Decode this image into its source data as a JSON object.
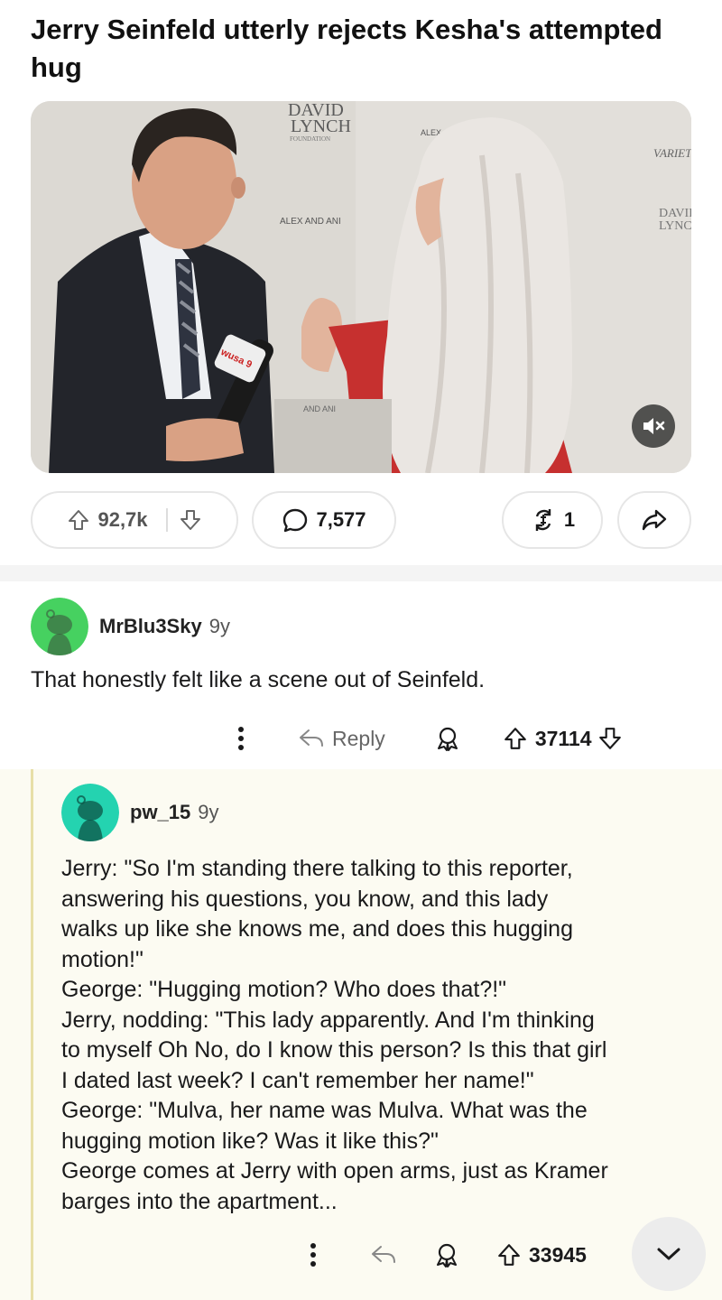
{
  "post": {
    "title": "Jerry Seinfeld utterly rejects Kesha's attempted hug",
    "media": {
      "backdrop_texts": [
        "DAVID",
        "LYNCH",
        "FOUNDATION",
        "ALEX AND ANI",
        "ALEX",
        "VARIETY",
        "DAVID",
        "LYNCH",
        "wusa 9",
        "AND ANI"
      ],
      "mute_icon": "speaker-muted-icon"
    },
    "actions": {
      "upvote_icon": "upvote-arrow-icon",
      "score": "92,7k",
      "downvote_icon": "downvote-arrow-icon",
      "comment_icon": "speech-bubble-icon",
      "comments": "7,577",
      "award_icon": "award-icon",
      "awards": "1",
      "share_icon": "share-arrow-icon"
    }
  },
  "comments": [
    {
      "username": "MrBlu3Sky",
      "age": "9y",
      "avatar_color": "#46d160",
      "text": "That honestly felt like a scene out of Seinfeld.",
      "more_icon": "more-vertical-icon",
      "reply_label": "Reply",
      "score": "37114"
    },
    {
      "username": "pw_15",
      "age": "9y",
      "avatar_color": "#24d3b0",
      "lines": [
        "Jerry: \"So I'm standing there talking to this reporter,",
        "answering his questions, you know, and this lady",
        "walks up like she knows me, and does this hugging",
        "motion!\"",
        "George: \"Hugging motion? Who does that?!\"",
        "Jerry, nodding: \"This lady apparently. And I'm thinking",
        "to myself Oh No, do I know this person? Is this that girl",
        "I dated last week? I can't remember her name!\"",
        "George: \"Mulva, her name was Mulva. What was the",
        "hugging motion like? Was it like this?\"",
        "George comes at Jerry with open arms, just as Kramer",
        "barges into the apartment..."
      ],
      "score": "33945",
      "collapse_icon": "chevron-down-icon"
    }
  ],
  "colors": {
    "thread_line": "#e7dfa8",
    "reply_background": "#fcfbf2"
  }
}
